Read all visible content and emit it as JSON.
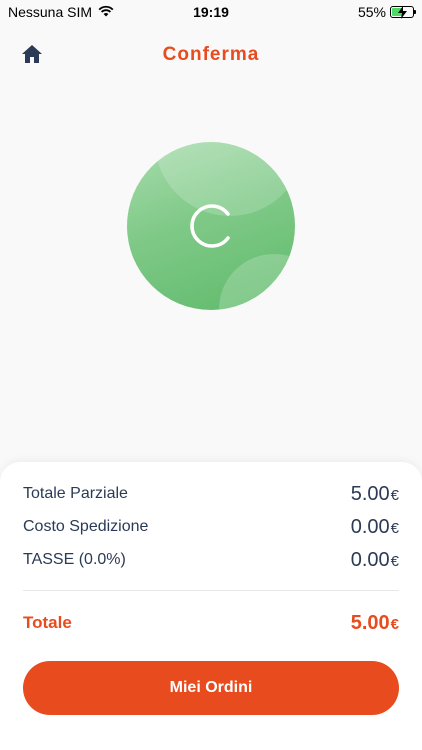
{
  "status_bar": {
    "carrier": "Nessuna SIM",
    "time": "19:19",
    "battery_percent": "55%",
    "battery_level": 0.55,
    "wifi_icon": "wifi-icon",
    "battery_icon": "battery-charging-icon"
  },
  "header": {
    "title": "Conferma",
    "home_icon": "home-icon"
  },
  "loader": {
    "mark": "C",
    "colors": {
      "top": "#a8dcae",
      "bottom": "#5fba6b"
    }
  },
  "summary": {
    "rows": [
      {
        "label": "Totale Parziale",
        "amount": "5.00",
        "currency": "€"
      },
      {
        "label": "Costo Spedizione",
        "amount": "0.00",
        "currency": "€"
      },
      {
        "label": "TASSE (0.0%)",
        "amount": "0.00",
        "currency": "€"
      }
    ],
    "total": {
      "label": "Totale",
      "amount": "5.00",
      "currency": "€"
    }
  },
  "actions": {
    "orders_label": "Miei Ordini"
  },
  "colors": {
    "accent": "#e84c1e",
    "text_dark": "#2b3a55",
    "home_icon": "#2b3a55",
    "background": "#f9f9f9"
  }
}
